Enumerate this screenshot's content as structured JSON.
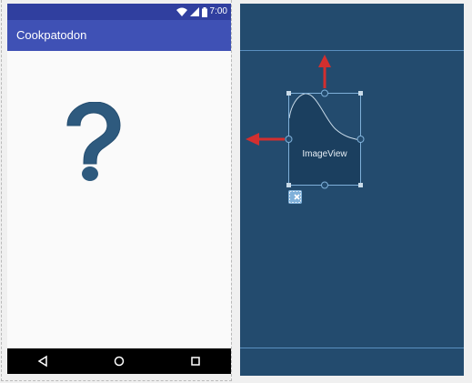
{
  "app": {
    "title": "Cookpatodon"
  },
  "status_bar": {
    "time": "7:00"
  },
  "image_view": {
    "label": "ImageView"
  },
  "icons": {
    "wifi": "wifi-icon",
    "battery": "battery-icon",
    "placeholder": "question-mark-icon",
    "back": "back-triangle-icon",
    "home": "home-circle-icon",
    "recents": "recents-square-icon",
    "constraint": "clear-constraints-icon"
  },
  "colors": {
    "status_bar": "#303f9f",
    "app_bar": "#3f51b5",
    "blueprint": "#234b6e",
    "placeholder": "#2e5a7e",
    "arrow": "#d32f2f"
  }
}
